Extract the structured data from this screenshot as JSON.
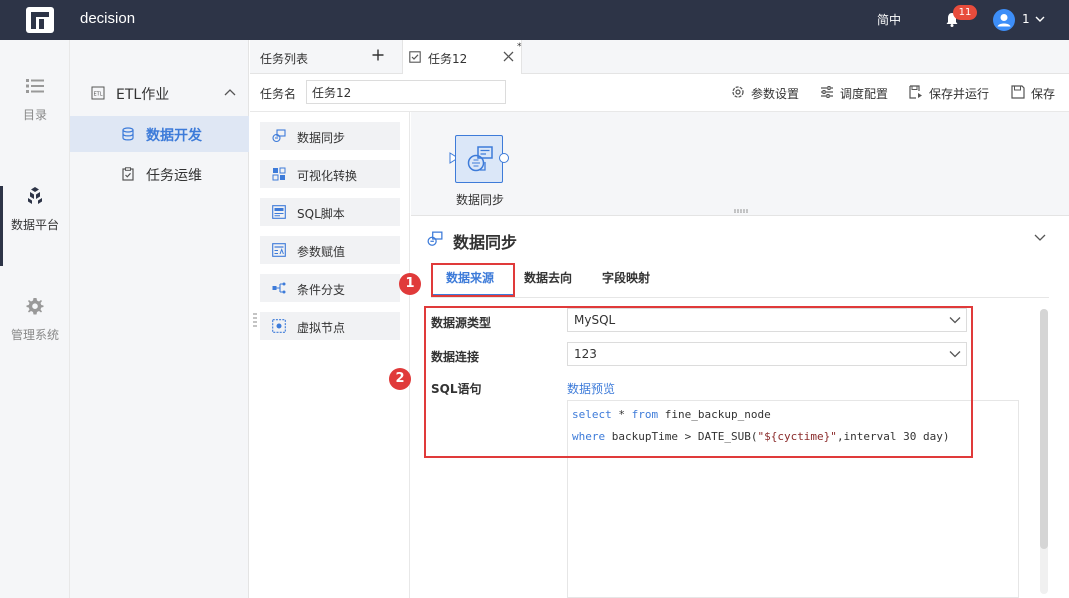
{
  "topbar": {
    "app_name": "decision",
    "language": "简中",
    "notification_count": "11",
    "user_name": "1"
  },
  "rail": {
    "items": [
      {
        "label": "目录",
        "icon": "list-icon"
      },
      {
        "label": "数据平台",
        "icon": "cubes-icon",
        "active": true
      },
      {
        "label": "管理系统",
        "icon": "gear-icon"
      }
    ]
  },
  "nav": {
    "group_label": "ETL作业",
    "items": [
      {
        "label": "数据开发",
        "icon": "database-icon",
        "active": true
      },
      {
        "label": "任务运维",
        "icon": "clipboard-icon"
      }
    ]
  },
  "tabs": {
    "list_label": "任务列表",
    "active_tab": "任务12",
    "unsaved_mark": "*"
  },
  "task": {
    "name_label": "任务名",
    "name_value": "任务12",
    "tools": [
      {
        "label": "参数设置",
        "icon": "settings-icon"
      },
      {
        "label": "调度配置",
        "icon": "sliders-icon"
      },
      {
        "label": "保存并运行",
        "icon": "save-run-icon"
      },
      {
        "label": "保存",
        "icon": "save-icon"
      }
    ]
  },
  "palette": {
    "items": [
      {
        "label": "数据同步",
        "icon": "data-sync-icon"
      },
      {
        "label": "可视化转换",
        "icon": "visual-transform-icon"
      },
      {
        "label": "SQL脚本",
        "icon": "sql-script-icon"
      },
      {
        "label": "参数赋值",
        "icon": "param-assign-icon"
      },
      {
        "label": "条件分支",
        "icon": "branch-icon"
      },
      {
        "label": "虚拟节点",
        "icon": "virtual-node-icon"
      }
    ]
  },
  "canvas": {
    "node_label": "数据同步"
  },
  "detail": {
    "title": "数据同步",
    "tabs": [
      "数据来源",
      "数据去向",
      "字段映射"
    ],
    "markers": [
      "1",
      "2"
    ],
    "fields": {
      "source_type_label": "数据源类型",
      "source_type_value": "MySQL",
      "connection_label": "数据连接",
      "connection_value": "123",
      "sql_label": "SQL语句",
      "preview_link": "数据预览"
    },
    "sql": {
      "l1_kw1": "select",
      "l1_mid": " * ",
      "l1_kw2": "from",
      "l1_rest": " fine_backup_node",
      "l2_kw": "where",
      "l2_a": " backupTime > DATE_SUB(",
      "l2_str": "\"${cyctime}\"",
      "l2_b": ",interval 30 day)"
    }
  },
  "colors": {
    "topbar_bg": "#2d3447",
    "accent": "#3d7bd9",
    "highlight_red": "#e03a3a"
  }
}
